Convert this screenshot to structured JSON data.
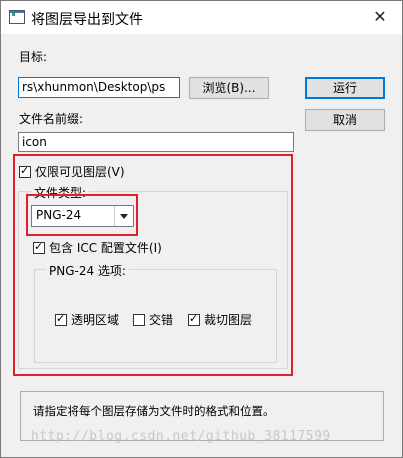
{
  "window": {
    "title": "将图层导出到文件",
    "close_glyph": "✕"
  },
  "target": {
    "label": "目标:",
    "value": "rs\\xhunmon\\Desktop\\ps",
    "browse_label": "浏览(B)..."
  },
  "prefix": {
    "label": "文件名前缀:",
    "value": "icon"
  },
  "buttons": {
    "run": "运行",
    "cancel": "取消"
  },
  "visible_only": {
    "label": "仅限可见图层(V)",
    "checked": true
  },
  "file_type": {
    "group_label": "文件类型:",
    "selected": "PNG-24"
  },
  "icc": {
    "label": "包含 ICC 配置文件(I)",
    "checked": true
  },
  "png_options": {
    "group_label": "PNG-24 选项:",
    "transparency": {
      "label": "透明区域",
      "checked": true
    },
    "interlaced": {
      "label": "交错",
      "checked": false
    },
    "trim": {
      "label": "裁切图层",
      "checked": true
    }
  },
  "status_text": "请指定将每个图层存储为文件时的格式和位置。",
  "watermark": "http://blog.csdn.net/github_38117599"
}
